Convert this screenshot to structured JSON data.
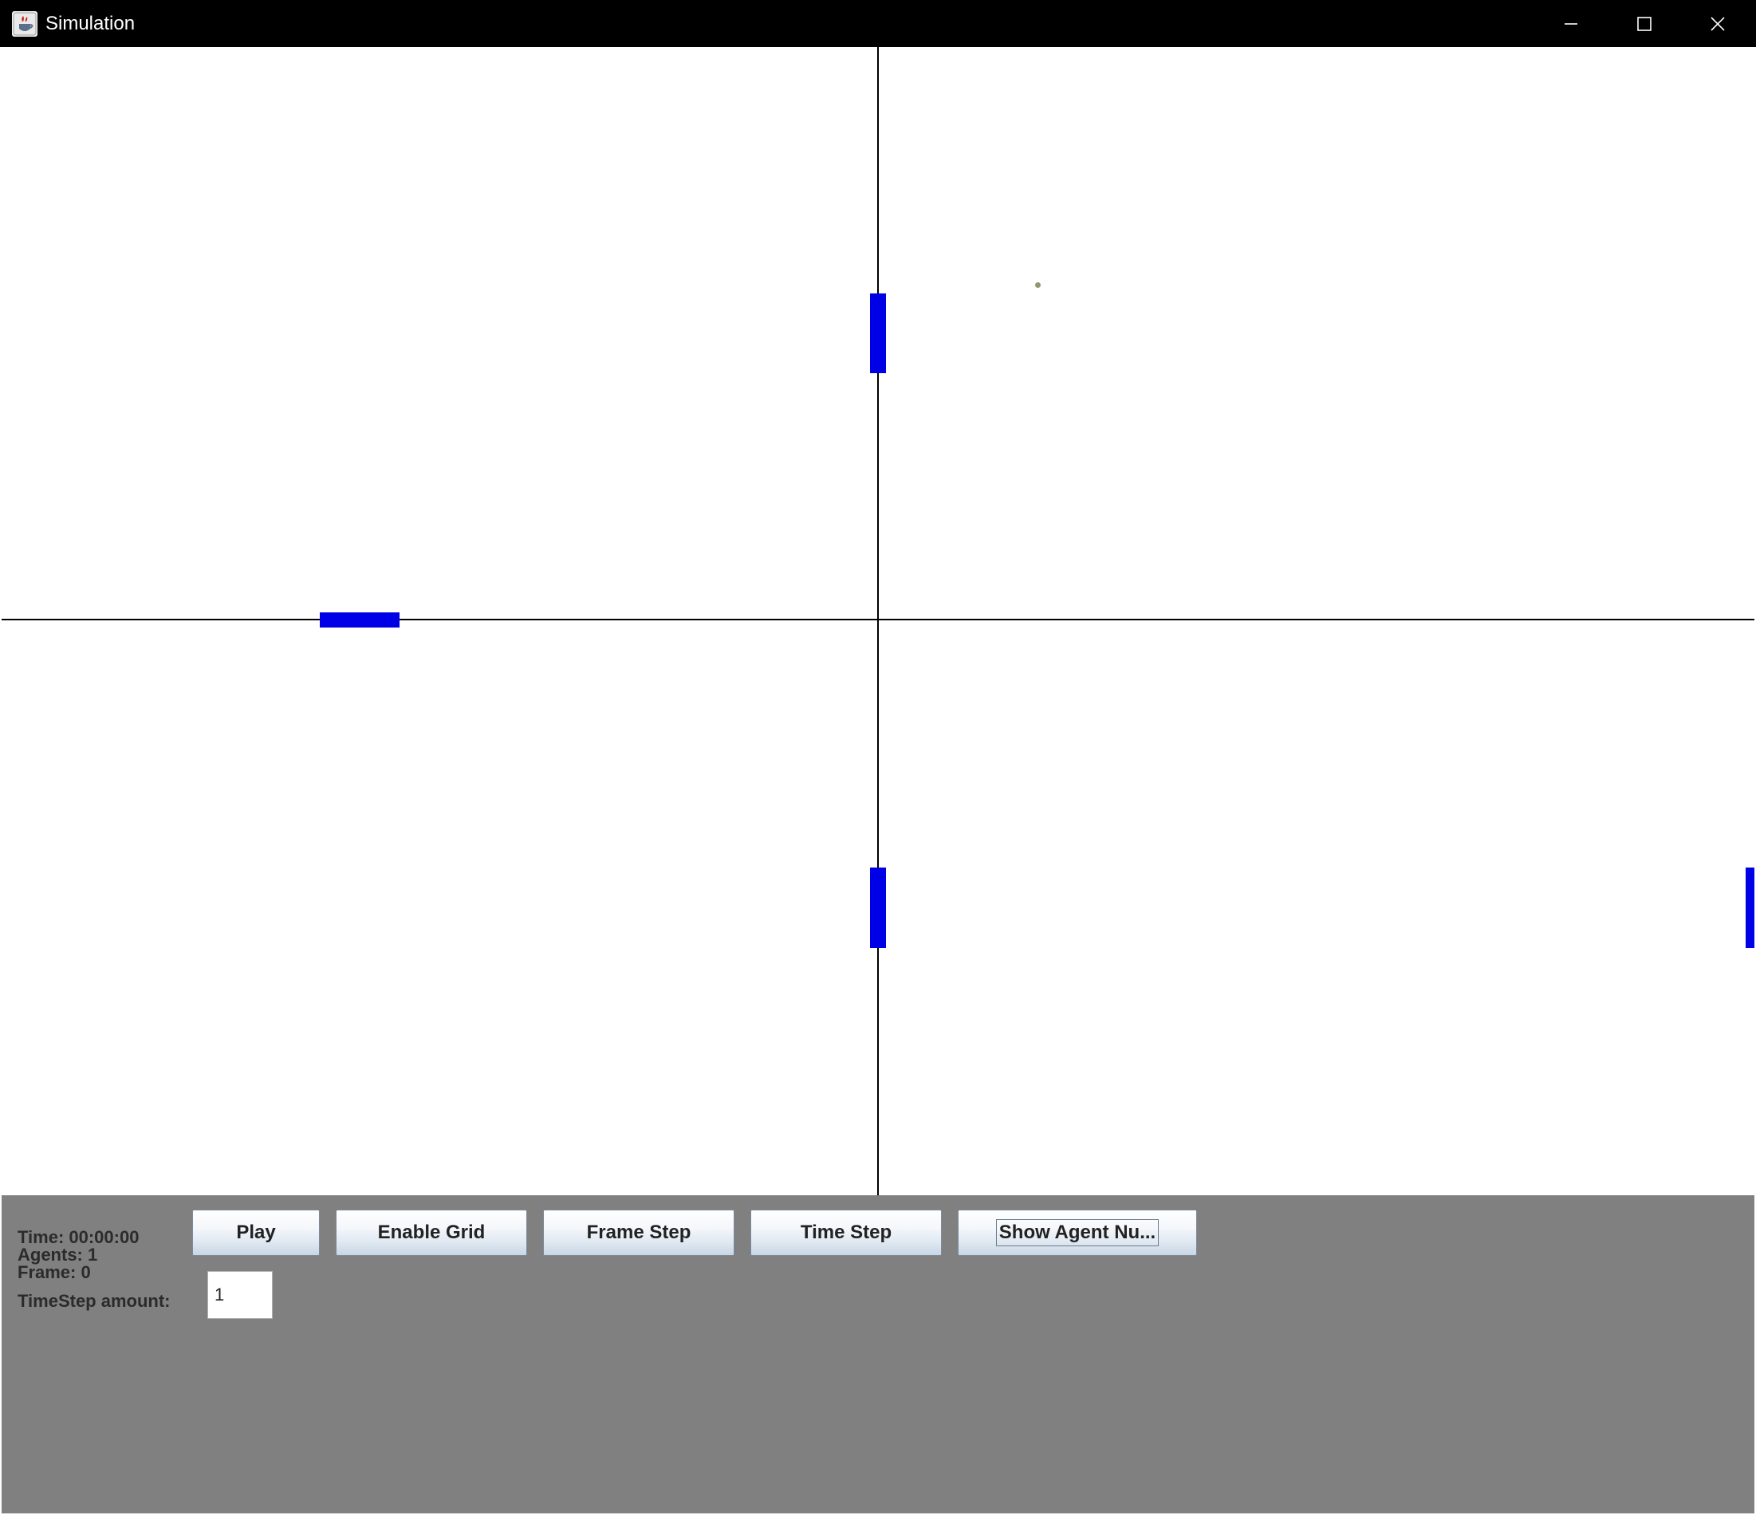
{
  "window": {
    "title": "Simulation",
    "icon": "java-coffee-icon",
    "controls": [
      "minimize-icon",
      "maximize-icon",
      "close-icon"
    ]
  },
  "colors": {
    "titlebar": "#000000",
    "canvas": "#ffffff",
    "grid_line": "#000000",
    "wall": "#0000e6",
    "agent": "#8c9a6e",
    "panel": "#808080"
  },
  "status": {
    "time": "Time: 00:00:00",
    "agents": "Agents: 1",
    "frame": "Frame: 0"
  },
  "toolbar": {
    "play_label": "Play",
    "enable_grid_label": "Enable Grid",
    "frame_step_label": "Frame Step",
    "time_step_label": "Time Step",
    "show_agent_label": "Show Agent Nu..."
  },
  "timestep": {
    "label": "TimeStep amount:",
    "value": "1"
  }
}
